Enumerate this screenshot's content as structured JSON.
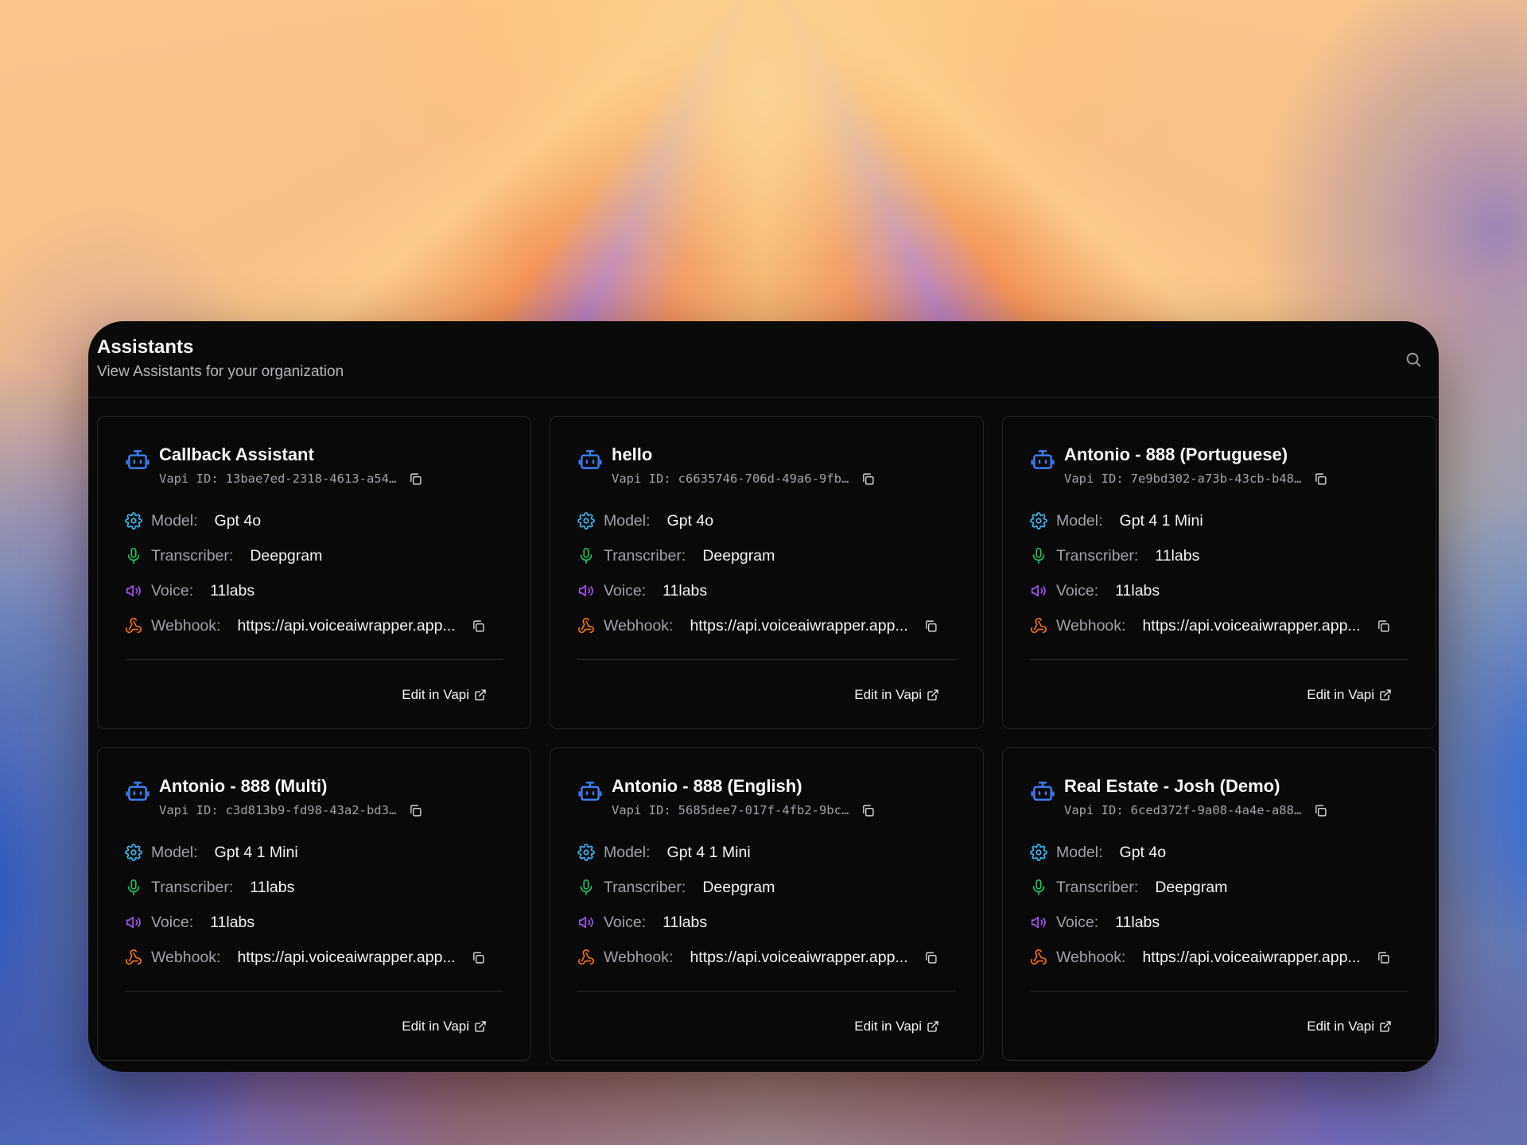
{
  "header": {
    "title": "Assistants",
    "subtitle": "View Assistants for your organization"
  },
  "labels": {
    "vapi_id": "Vapi ID:",
    "model": "Model:",
    "transcriber": "Transcriber:",
    "voice": "Voice:",
    "webhook": "Webhook:",
    "edit": "Edit in Vapi"
  },
  "icons": {
    "assistant": "bot-icon",
    "model": "gear-icon",
    "transcriber": "mic-icon",
    "voice": "speaker-icon",
    "webhook": "webhook-icon",
    "copy": "copy-icon",
    "external": "external-link-icon",
    "search": "search-icon"
  },
  "colors": {
    "window_bg": "#0a0a0b",
    "bot": "#3b82f6",
    "model": "#38bdf8",
    "transcriber": "#22c55e",
    "voice": "#a855f7",
    "webhook": "#f97316"
  },
  "assistants": [
    {
      "name": "Callback Assistant",
      "vapi_id": "13bae7ed-2318-4613-a54…",
      "model": "Gpt 4o",
      "transcriber": "Deepgram",
      "voice": "11labs",
      "webhook": "https://api.voiceaiwrapper.app..."
    },
    {
      "name": "hello",
      "vapi_id": "c6635746-706d-49a6-9fb…",
      "model": "Gpt 4o",
      "transcriber": "Deepgram",
      "voice": "11labs",
      "webhook": "https://api.voiceaiwrapper.app..."
    },
    {
      "name": "Antonio - 888 (Portuguese)",
      "vapi_id": "7e9bd302-a73b-43cb-b48…",
      "model": "Gpt 4 1 Mini",
      "transcriber": "11labs",
      "voice": "11labs",
      "webhook": "https://api.voiceaiwrapper.app..."
    },
    {
      "name": "Antonio - 888 (Multi)",
      "vapi_id": "c3d813b9-fd98-43a2-bd3…",
      "model": "Gpt 4 1 Mini",
      "transcriber": "11labs",
      "voice": "11labs",
      "webhook": "https://api.voiceaiwrapper.app..."
    },
    {
      "name": "Antonio - 888 (English)",
      "vapi_id": "5685dee7-017f-4fb2-9bc…",
      "model": "Gpt 4 1 Mini",
      "transcriber": "Deepgram",
      "voice": "11labs",
      "webhook": "https://api.voiceaiwrapper.app..."
    },
    {
      "name": "Real Estate - Josh (Demo)",
      "vapi_id": "6ced372f-9a08-4a4e-a88…",
      "model": "Gpt 4o",
      "transcriber": "Deepgram",
      "voice": "11labs",
      "webhook": "https://api.voiceaiwrapper.app..."
    }
  ]
}
